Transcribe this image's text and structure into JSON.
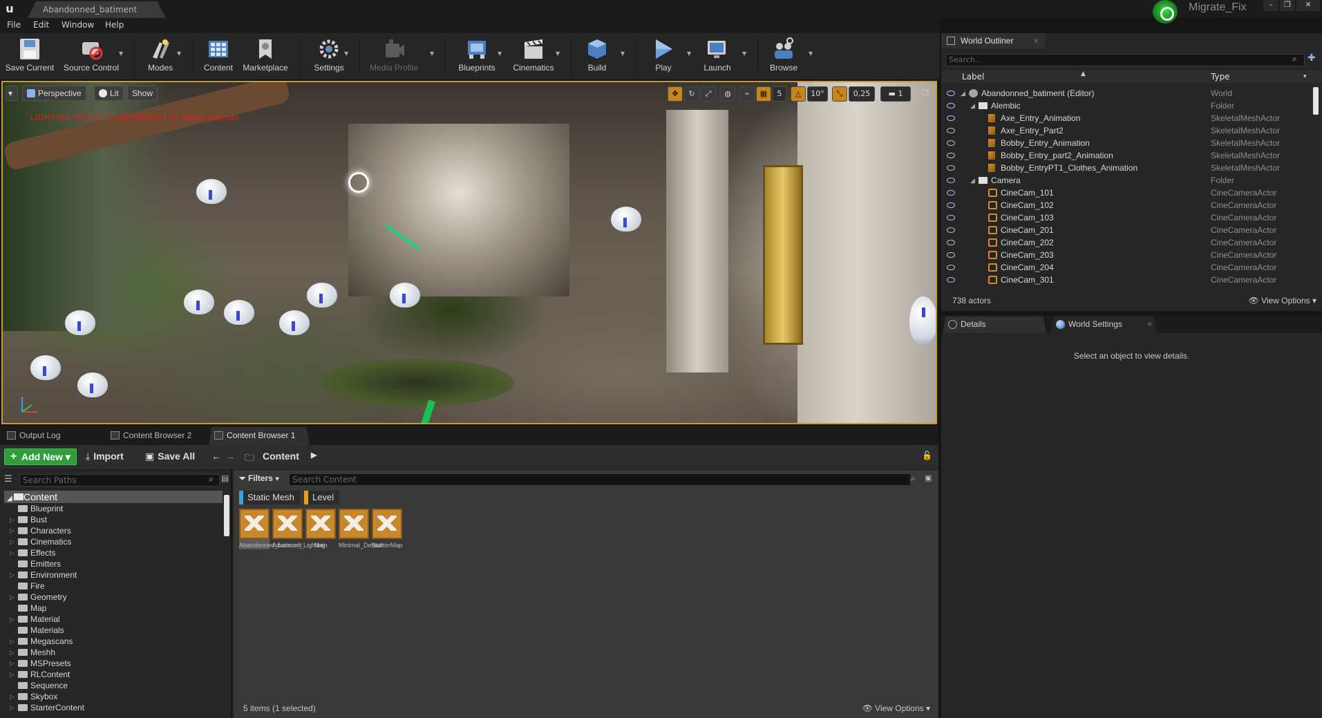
{
  "window": {
    "tab_title": "Abandonned_batiment",
    "project_name": "Migrate_Fix",
    "controls": [
      "–",
      "❐",
      "✕"
    ]
  },
  "menu": [
    "File",
    "Edit",
    "Window",
    "Help"
  ],
  "toolbar": {
    "buttons": [
      {
        "label": "Save Current",
        "icon": "save-icon",
        "disabled": false
      },
      {
        "label": "Source Control",
        "icon": "source-control-icon",
        "disabled": false
      },
      {
        "label": "Modes",
        "icon": "modes-icon",
        "disabled": false
      },
      {
        "label": "Content",
        "icon": "content-icon",
        "disabled": false
      },
      {
        "label": "Marketplace",
        "icon": "marketplace-icon",
        "disabled": false
      },
      {
        "label": "Settings",
        "icon": "settings-icon",
        "disabled": false
      },
      {
        "label": "Media Profile",
        "icon": "media-profile-icon",
        "disabled": true
      },
      {
        "label": "Blueprints",
        "icon": "blueprints-icon",
        "disabled": false
      },
      {
        "label": "Cinematics",
        "icon": "cinematics-icon",
        "disabled": false
      },
      {
        "label": "Build",
        "icon": "build-icon",
        "disabled": false
      },
      {
        "label": "Play",
        "icon": "play-icon",
        "disabled": false
      },
      {
        "label": "Launch",
        "icon": "launch-icon",
        "disabled": false
      },
      {
        "label": "Browse",
        "icon": "browse-icon",
        "disabled": false
      }
    ]
  },
  "viewport": {
    "perspective_label": "Perspective",
    "lit_label": "Lit",
    "show_label": "Show",
    "warning": "LIGHTING NEEDS TO BE REBUILT (4 unbuilt objects)",
    "grid_snap": "5",
    "rotation_snap": "10°",
    "scale_snap": "0,25",
    "camera_speed": "1"
  },
  "bottom_tabs": [
    "Output Log",
    "Content Browser 2",
    "Content Browser 1"
  ],
  "content_browser": {
    "add_new": "Add New",
    "import": "Import",
    "save_all": "Save All",
    "path": "Content",
    "search_paths_placeholder": "Search Paths",
    "filters_label": "Filters",
    "search_content_placeholder": "Search Content",
    "filter_chips": [
      {
        "label": "Static Mesh",
        "color": "#3fa1d8"
      },
      {
        "label": "Level",
        "color": "#e0a020"
      }
    ],
    "root_folder": "Content",
    "folders": [
      "Blueprint",
      "Bust",
      "Characters",
      "Cinematics",
      "Effects",
      "Emitters",
      "Environment",
      "Fire",
      "Geometry",
      "Map",
      "Material",
      "Materials",
      "Megascans",
      "Meshh",
      "MSPresets",
      "RLContent",
      "Sequence",
      "Skybox",
      "StarterContent"
    ],
    "assets": [
      {
        "label": "Abandonned_batiment",
        "selected": true
      },
      {
        "label": "Advanced_Lighting",
        "selected": false
      },
      {
        "label": "Main",
        "selected": false
      },
      {
        "label": "Minimal_Default",
        "selected": false
      },
      {
        "label": "StarterMap",
        "selected": false
      }
    ],
    "status": "5 items (1 selected)",
    "view_options": "View Options"
  },
  "outliner": {
    "tab_label": "World Outliner",
    "search_placeholder": "Search...",
    "col_label": "Label",
    "col_type": "Type",
    "rows": [
      {
        "name": "Abandonned_batiment (Editor)",
        "type": "World",
        "depth": 0,
        "kind": "world"
      },
      {
        "name": "Alembic",
        "type": "Folder",
        "depth": 1,
        "kind": "folder"
      },
      {
        "name": "Axe_Entry_Animation",
        "type": "SkeletalMeshActor",
        "depth": 2,
        "kind": "actor"
      },
      {
        "name": "Axe_Entry_Part2",
        "type": "SkeletalMeshActor",
        "depth": 2,
        "kind": "actor"
      },
      {
        "name": "Bobby_Entry_Animation",
        "type": "SkeletalMeshActor",
        "depth": 2,
        "kind": "actor"
      },
      {
        "name": "Bobby_Entry_part2_Animation",
        "type": "SkeletalMeshActor",
        "depth": 2,
        "kind": "actor"
      },
      {
        "name": "Bobby_EntryPT1_Clothes_Animation",
        "type": "SkeletalMeshActor",
        "depth": 2,
        "kind": "actor"
      },
      {
        "name": "Camera",
        "type": "Folder",
        "depth": 1,
        "kind": "folder"
      },
      {
        "name": "CineCam_101",
        "type": "CineCameraActor",
        "depth": 2,
        "kind": "camera"
      },
      {
        "name": "CineCam_102",
        "type": "CineCameraActor",
        "depth": 2,
        "kind": "camera"
      },
      {
        "name": "CineCam_103",
        "type": "CineCameraActor",
        "depth": 2,
        "kind": "camera"
      },
      {
        "name": "CineCam_201",
        "type": "CineCameraActor",
        "depth": 2,
        "kind": "camera"
      },
      {
        "name": "CineCam_202",
        "type": "CineCameraActor",
        "depth": 2,
        "kind": "camera"
      },
      {
        "name": "CineCam_203",
        "type": "CineCameraActor",
        "depth": 2,
        "kind": "camera"
      },
      {
        "name": "CineCam_204",
        "type": "CineCameraActor",
        "depth": 2,
        "kind": "camera"
      },
      {
        "name": "CineCam_301",
        "type": "CineCameraActor",
        "depth": 2,
        "kind": "camera"
      }
    ],
    "actor_count": "738 actors",
    "view_options": "View Options"
  },
  "details": {
    "tabs": [
      "Details",
      "World Settings"
    ],
    "empty_message": "Select an object to view details."
  }
}
